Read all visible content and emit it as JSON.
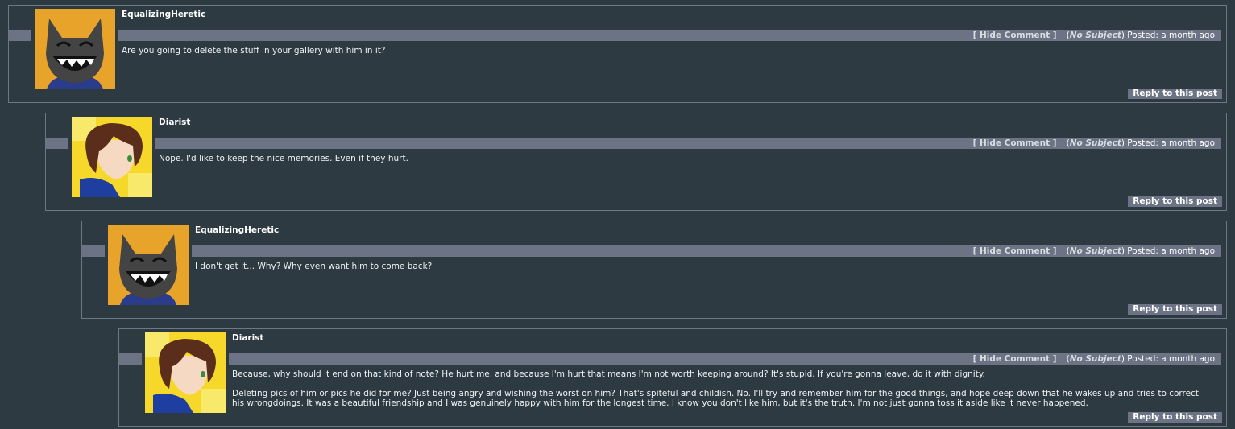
{
  "colors": {
    "background": "#2e3a42",
    "bar": "#6b7384",
    "border": "#6d7886"
  },
  "comments": [
    {
      "username": "EqualizingHeretic",
      "avatar": "cat-grin",
      "hide_label": "[ Hide Comment ]",
      "subject_open": "(",
      "subject": "No Subject",
      "posted": ") Posted: a month ago",
      "paragraphs": [
        "Are you going to delete the stuff in your gallery with him in it?"
      ],
      "reply_label": "Reply to this post"
    },
    {
      "username": "Diarist",
      "avatar": "anime-boy",
      "hide_label": "[ Hide Comment ]",
      "subject_open": "(",
      "subject": "No Subject",
      "posted": ") Posted: a month ago",
      "paragraphs": [
        "Nope. I'd like to keep the nice memories. Even if they hurt."
      ],
      "reply_label": "Reply to this post"
    },
    {
      "username": "EqualizingHeretic",
      "avatar": "cat-grin",
      "hide_label": "[ Hide Comment ]",
      "subject_open": "(",
      "subject": "No Subject",
      "posted": ") Posted: a month ago",
      "paragraphs": [
        "I don't get it... Why? Why even want him to come back?"
      ],
      "reply_label": "Reply to this post"
    },
    {
      "username": "Diarist",
      "avatar": "anime-boy",
      "hide_label": "[ Hide Comment ]",
      "subject_open": "(",
      "subject": "No Subject",
      "posted": ") Posted: a month ago",
      "paragraphs": [
        "Because, why should it end on that kind of note? He hurt me, and because I'm hurt that means I'm not worth keeping around? It's stupid. If you're gonna leave, do it with dignity.",
        "Deleting pics of him or pics he did for me? Just being angry and wishing the worst on him? That's spiteful and childish. No. I'll try and remember him for the good things, and hope deep down that he wakes up and tries to correct his wrongdoings. It was a beautiful friendship and I was genuinely happy with him for the longest time. I know you don't like him, but it's the truth. I'm not just gonna toss it aside like it never happened."
      ],
      "reply_label": "Reply to this post"
    }
  ]
}
